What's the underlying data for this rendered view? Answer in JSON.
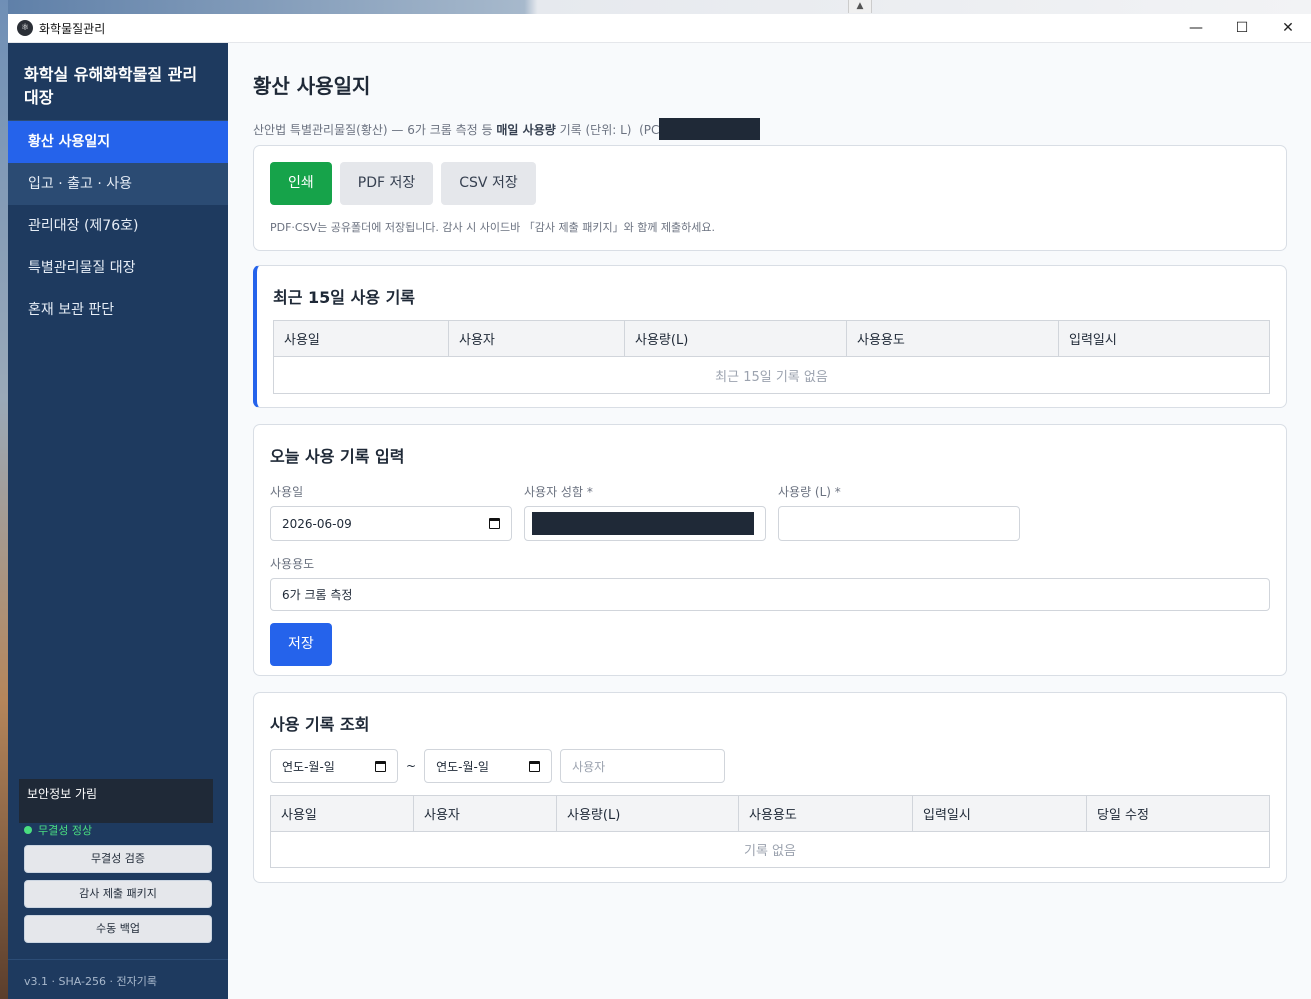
{
  "window": {
    "title": "화학물질관리",
    "controls": {
      "minimize": "—",
      "maximize": "☐",
      "close": "✕"
    }
  },
  "sidebar": {
    "title": "화학실 유해화학물질 관리 대장",
    "items": [
      {
        "label": "황산 사용일지",
        "active": true
      },
      {
        "label": "입고 · 출고 · 사용",
        "active": false
      },
      {
        "label": "관리대장 (제76호)",
        "active": false
      },
      {
        "label": "특별관리물질 대장",
        "active": false
      },
      {
        "label": "혼재 보관 판단",
        "active": false
      }
    ],
    "security_label": "보안정보 가림",
    "integrity_status": "무결성 정상",
    "buttons": {
      "verify": "무결성 검증",
      "audit": "감사 제출 패키지",
      "backup": "수동 백업"
    },
    "footer": "v3.1 · SHA-256 · 전자기록"
  },
  "main": {
    "title": "황산 사용일지",
    "subtitle_prefix": "산안법 특별관리물질(황산) — 6가 크롬 측정 등 ",
    "subtitle_bold": "매일 사용량",
    "subtitle_suffix": " 기록 (단위: L)  (PC",
    "export": {
      "print_label": "인쇄",
      "pdf_label": "PDF 저장",
      "csv_label": "CSV 저장",
      "hint": "PDF·CSV는 공유폴더에 저장됩니다. 감사 시 사이드바 「감사 제출 패키지」와 함께 제출하세요."
    },
    "recent": {
      "title": "최근 15일 사용 기록",
      "columns": [
        "사용일",
        "사용자",
        "사용량(L)",
        "사용용도",
        "입력일시"
      ],
      "empty": "최근 15일 기록 없음"
    },
    "form": {
      "title": "오늘 사용 기록 입력",
      "date_label": "사용일",
      "date_value": "2026-06-09",
      "user_label": "사용자 성함 *",
      "amount_label": "사용량 (L) *",
      "amount_value": "",
      "purpose_label": "사용용도",
      "purpose_value": "6가 크롬 측정",
      "save_label": "저장"
    },
    "query": {
      "title": "사용 기록 조회",
      "from_placeholder": "연도-월-일",
      "separator": "~",
      "to_placeholder": "연도-월-일",
      "user_placeholder": "사용자",
      "columns": [
        "사용일",
        "사용자",
        "사용량(L)",
        "사용용도",
        "입력일시",
        "당일 수정"
      ],
      "empty": "기록 없음"
    }
  },
  "colors": {
    "sidebar_bg": "#1e3a5f",
    "active_nav": "#2563eb",
    "print_btn": "#16a34a",
    "save_btn": "#2563eb",
    "integrity_ok": "#4ade80"
  }
}
